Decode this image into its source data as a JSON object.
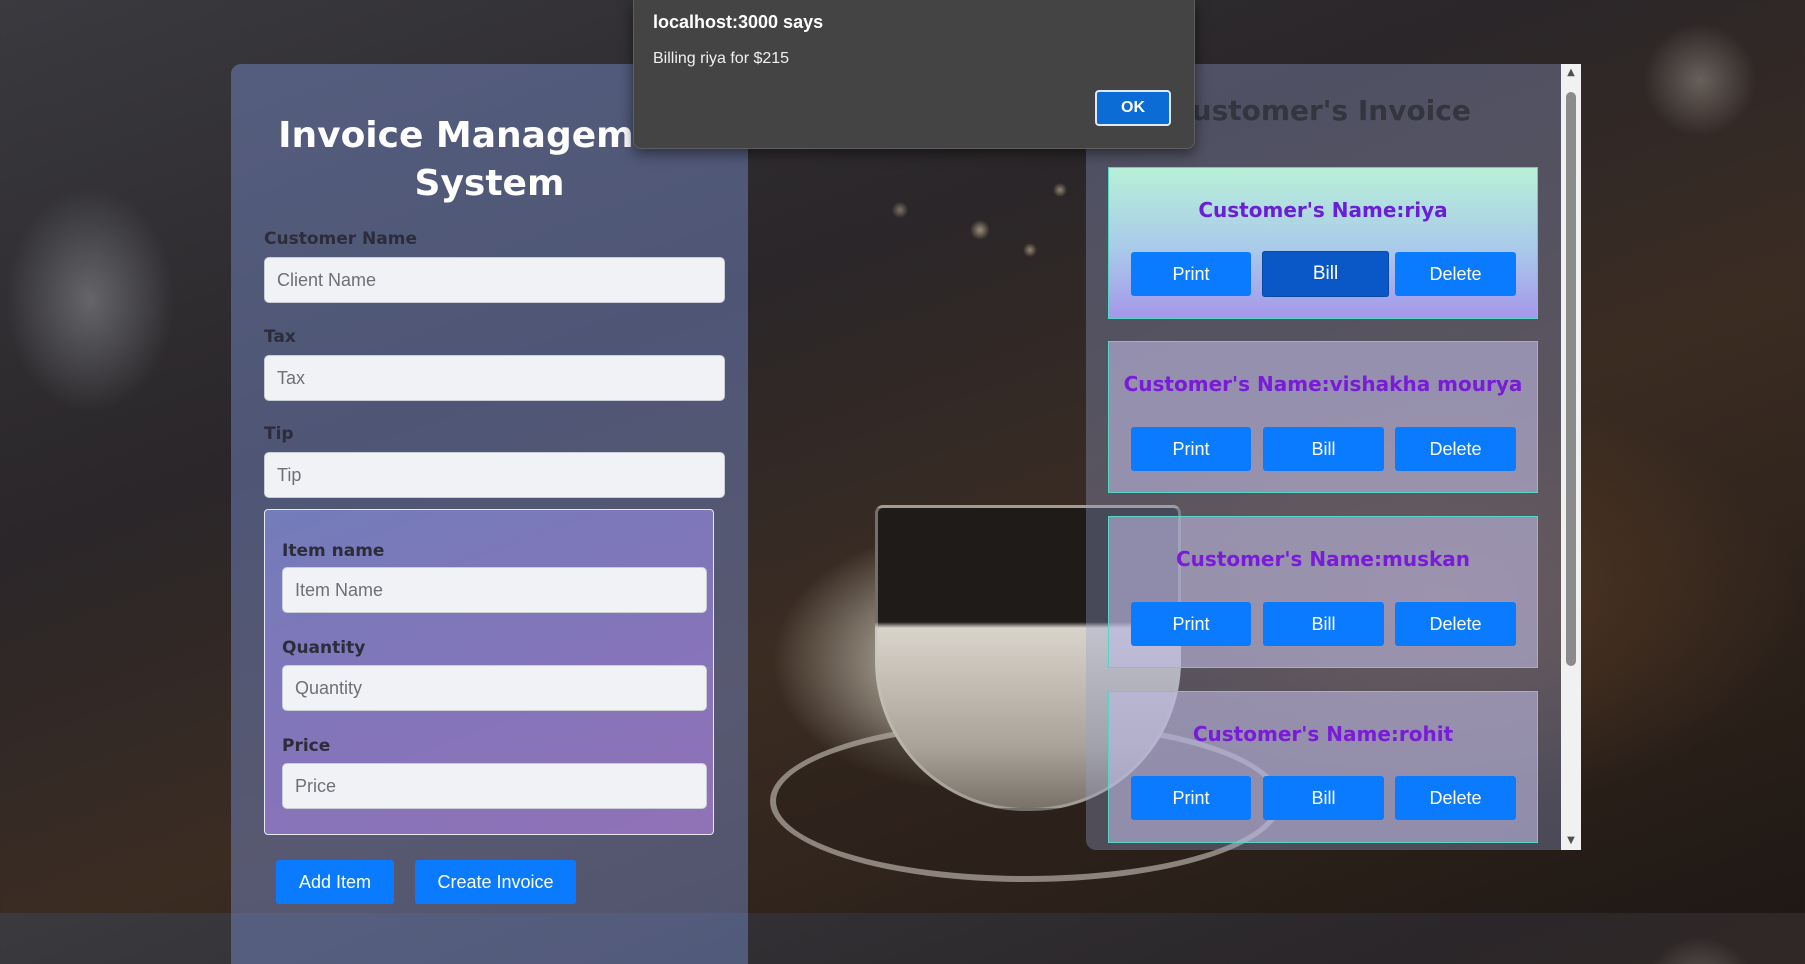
{
  "form": {
    "title": "Invoice Management System",
    "customer_name": {
      "label": "Customer Name",
      "placeholder": "Client Name",
      "value": ""
    },
    "tax": {
      "label": "Tax",
      "placeholder": "Tax",
      "value": ""
    },
    "tip": {
      "label": "Tip",
      "placeholder": "Tip",
      "value": ""
    },
    "item_name": {
      "label": "Item name",
      "placeholder": "Item Name",
      "value": ""
    },
    "quantity": {
      "label": "Quantity",
      "placeholder": "Quantity",
      "value": ""
    },
    "price": {
      "label": "Price",
      "placeholder": "Price",
      "value": ""
    },
    "add_item_label": "Add Item",
    "create_invoice_label": "Create Invoice"
  },
  "invoices": {
    "title": "Customer's Invoice",
    "cards": [
      {
        "name": "Customer's Name:riya",
        "print": "Print",
        "bill": "Bill",
        "delete": "Delete"
      },
      {
        "name": "Customer's Name:vishakha mourya",
        "print": "Print",
        "bill": "Bill",
        "delete": "Delete"
      },
      {
        "name": "Customer's Name:muskan",
        "print": "Print",
        "bill": "Bill",
        "delete": "Delete"
      },
      {
        "name": "Customer's Name:rohit",
        "print": "Print",
        "bill": "Bill",
        "delete": "Delete"
      }
    ]
  },
  "dialog": {
    "title": "localhost:3000 says",
    "message": "Billing riya for $215",
    "ok_label": "OK"
  },
  "colors": {
    "button": "#0a7bff",
    "button_pressed": "#0a58c7",
    "customer_name": "#7a1bd9",
    "card_border": "#57d6c7"
  },
  "icons": {
    "scroll_up": "scroll-up-arrow-icon",
    "scroll_down": "scroll-down-arrow-icon"
  }
}
